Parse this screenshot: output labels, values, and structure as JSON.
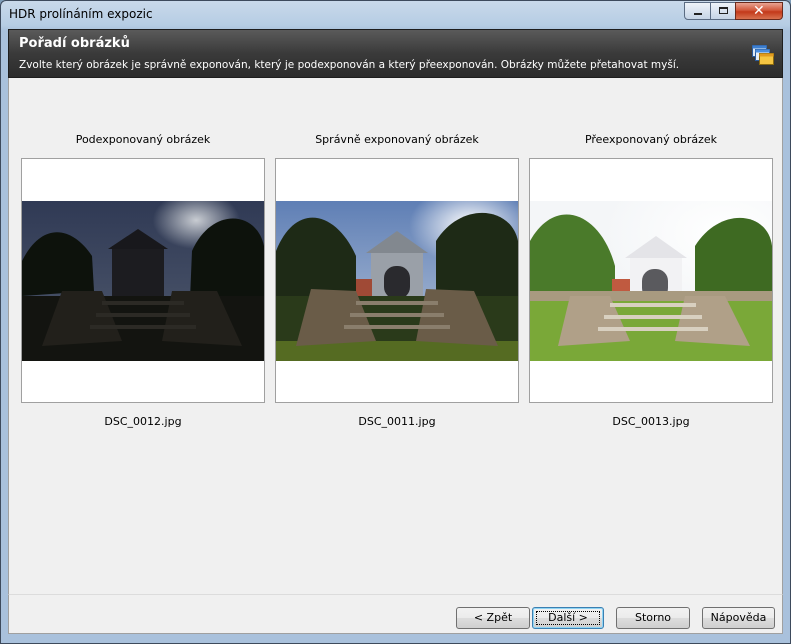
{
  "window": {
    "title": "HDR prolínáním expozic"
  },
  "header": {
    "title": "Pořadí obrázků",
    "subtitle": "Zvolte který obrázek je správně exponován, který je podexponován a který přeexponován. Obrázky můžete přetahovat myší.",
    "icon": "windows-stack-icon"
  },
  "images": [
    {
      "label": "Podexponovaný obrázek",
      "filename": "DSC_0012.jpg",
      "exposure": "under"
    },
    {
      "label": "Správně exponovaný obrázek",
      "filename": "DSC_0011.jpg",
      "exposure": "normal"
    },
    {
      "label": "Přeexponovaný obrázek",
      "filename": "DSC_0013.jpg",
      "exposure": "over"
    }
  ],
  "buttons": {
    "back": "< Zpět",
    "next": "Další >",
    "cancel": "Storno",
    "help": "Nápověda"
  },
  "colors": {
    "header_bg": "#3a3a3a",
    "window_frame": "#b6cde4",
    "content_bg": "#f0f0f0"
  }
}
